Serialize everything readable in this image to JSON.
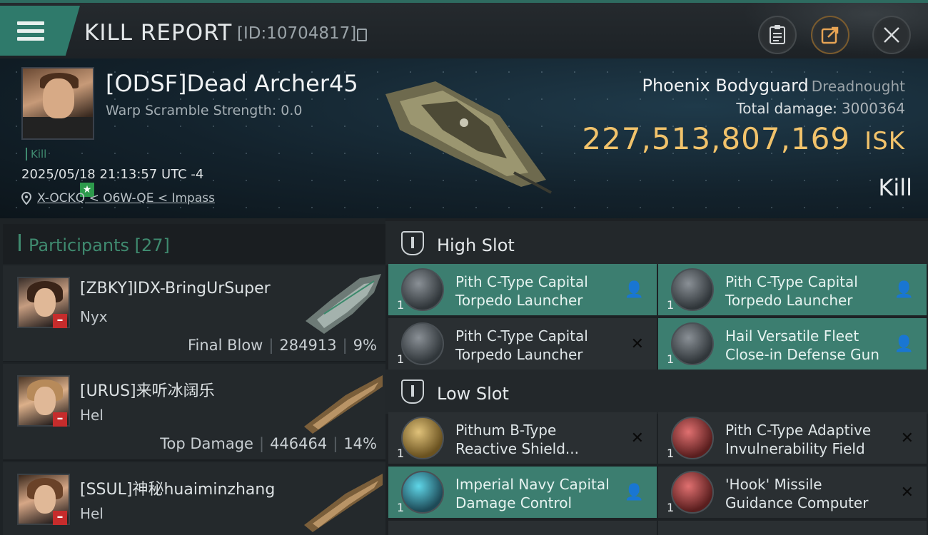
{
  "header": {
    "title": "KILL REPORT",
    "report_id": "[ID:10704817]"
  },
  "victim": {
    "name": "[ODSF]Dead Archer45",
    "warp_scramble": "Warp Scramble Strength: 0.0",
    "tag": "Kill",
    "datetime": "2025/05/18 21:13:57 UTC -4",
    "location": "X-OCKQ < O6W-QE < Impass",
    "ship_name": "Phoenix Bodyguard",
    "ship_class": "Dreadnought",
    "total_damage_label": "Total damage:",
    "total_damage_value": "3000364",
    "isk_value": "227,513,807,169",
    "isk_unit": "ISK",
    "result_label": "Kill"
  },
  "participants": {
    "header": "Participants [27]",
    "items": [
      {
        "name": "[ZBKY]IDX-BringUrSuper",
        "ship": "Nyx",
        "role": "Final Blow",
        "damage": "284913",
        "percent": "9%"
      },
      {
        "name": "[URUS]来听冰阔乐",
        "ship": "Hel",
        "role": "Top Damage",
        "damage": "446464",
        "percent": "14%"
      },
      {
        "name": "[SSUL]神秘huaiminzhang",
        "ship": "Hel",
        "role": "",
        "damage": "",
        "percent": ""
      }
    ]
  },
  "high_slot": {
    "label": "High Slot",
    "modules": [
      {
        "qty": "1",
        "name": "Pith C-Type Capital Torpedo Launcher",
        "fitted": true
      },
      {
        "qty": "1",
        "name": "Pith C-Type Capital Torpedo Launcher",
        "fitted": true
      },
      {
        "qty": "1",
        "name": "Pith C-Type Capital Torpedo Launcher",
        "fitted": false
      },
      {
        "qty": "1",
        "name": "Hail Versatile Fleet Close-in Defense Gun",
        "fitted": true
      }
    ]
  },
  "low_slot": {
    "label": "Low Slot",
    "modules": [
      {
        "qty": "1",
        "name": "Pithum B-Type Reactive Shield...",
        "fitted": false
      },
      {
        "qty": "1",
        "name": "Pith C-Type Adaptive Invulnerability Field",
        "fitted": false
      },
      {
        "qty": "1",
        "name": "Imperial Navy Capital Damage Control",
        "fitted": true
      },
      {
        "qty": "1",
        "name": "'Hook' Missile Guidance Computer",
        "fitted": false
      }
    ]
  },
  "icons": {
    "menu": "menu-icon",
    "copy": "copy-icon",
    "clipboard": "clipboard-icon",
    "share": "share-icon",
    "close": "close-icon",
    "pin": "location-pin-icon",
    "shield": "shield-slot-icon",
    "pilot": "pilot-icon",
    "destroyed": "destroyed-x-icon"
  },
  "colors": {
    "accent": "#3c7e70",
    "isk": "#f2c36b",
    "kill_tag": "#3f8a6f",
    "minus_badge": "#c62c2c",
    "star_badge": "#2d9a4c"
  }
}
